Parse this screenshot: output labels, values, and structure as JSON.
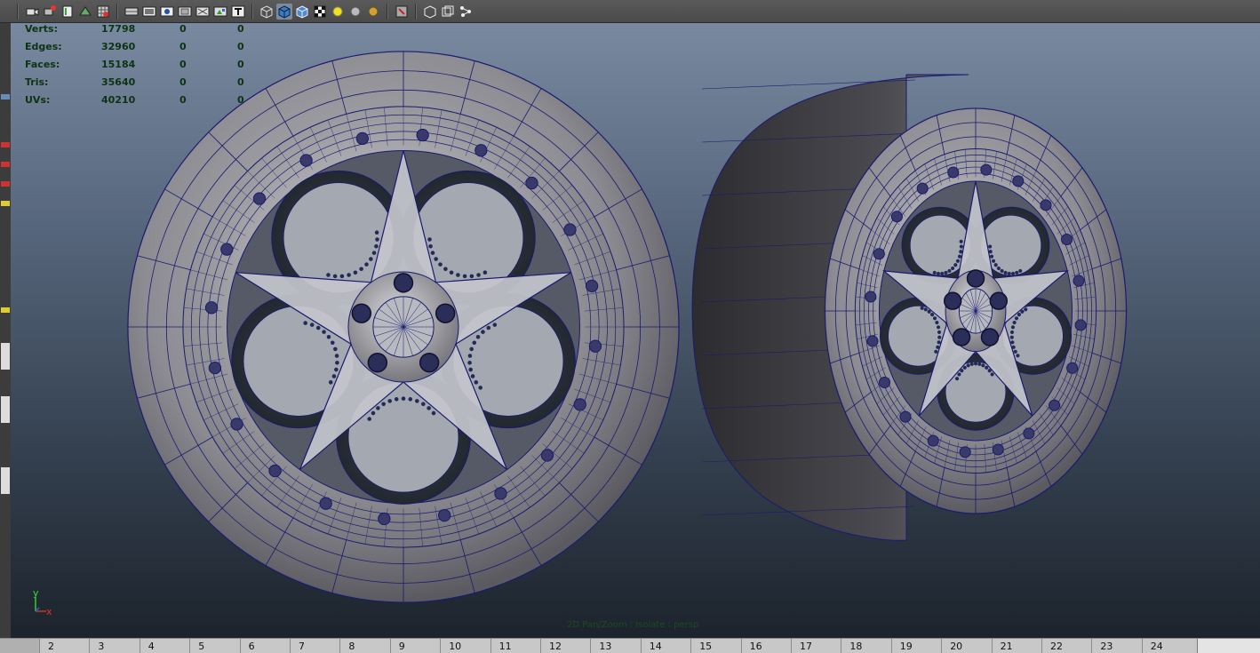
{
  "toolbar": {
    "icons": [
      "camera-icon",
      "camera-attributes-icon",
      "bookmark-icon",
      "image-plane-icon",
      "grid-icon",
      "film-gate-icon",
      "resolution-gate-icon",
      "gate-mask-icon",
      "field-chart-icon",
      "safe-action-icon",
      "safe-title-icon",
      "wireframe-icon",
      "smooth-shade-icon",
      "wireframe-on-shaded-icon",
      "textured-icon",
      "use-all-lights-icon",
      "shadows-icon",
      "ambient-occlusion-icon",
      "isolate-select-icon",
      "xray-icon",
      "xray-active-components-icon",
      "xray-joints-icon"
    ]
  },
  "hud": {
    "rows": [
      {
        "label": "Verts:",
        "v1": "17798",
        "v2": "0",
        "v3": "0"
      },
      {
        "label": "Edges:",
        "v1": "32960",
        "v2": "0",
        "v3": "0"
      },
      {
        "label": "Faces:",
        "v1": "15184",
        "v2": "0",
        "v3": "0"
      },
      {
        "label": "Tris:",
        "v1": "35640",
        "v2": "0",
        "v3": "0"
      },
      {
        "label": "UVs:",
        "v1": "40210",
        "v2": "0",
        "v3": "0"
      }
    ]
  },
  "viewport": {
    "camera_label": "2D Pan/Zoom : Isolate : persp",
    "axis_y": "y",
    "axis_x": "x"
  },
  "timeslider": {
    "ticks": [
      "2",
      "3",
      "4",
      "5",
      "6",
      "7",
      "8",
      "9",
      "10",
      "11",
      "12",
      "13",
      "14",
      "15",
      "16",
      "17",
      "18",
      "19",
      "20",
      "21",
      "22",
      "23",
      "24"
    ]
  },
  "colors": {
    "wire": "#1a1a70",
    "hud_text": "#0d3312"
  }
}
